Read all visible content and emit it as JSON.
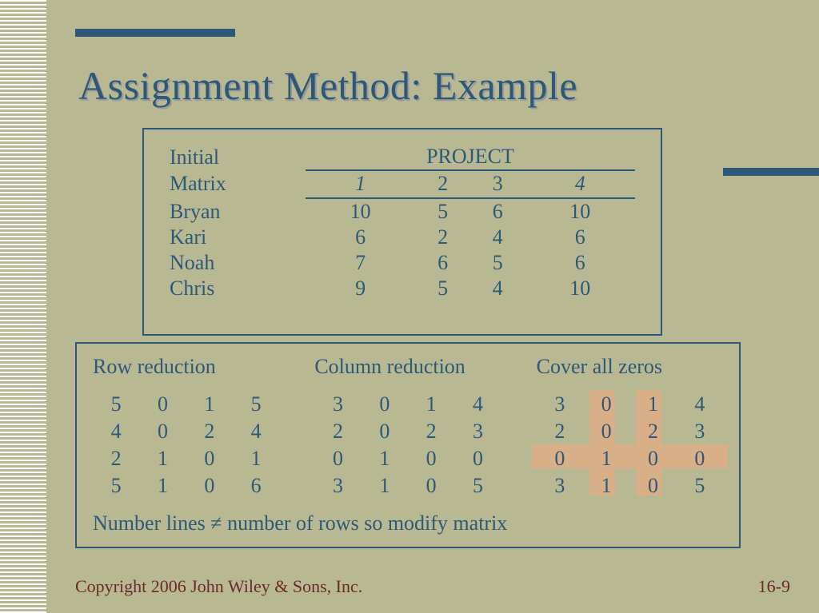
{
  "title": "Assignment Method: Example",
  "initial": {
    "label1": "Initial",
    "proj_header": "PROJECT",
    "label2": "Matrix",
    "cols": [
      "1",
      "2",
      "3",
      "4"
    ],
    "rows": [
      {
        "name": "Bryan",
        "v": [
          "10",
          "5",
          "6",
          "10"
        ]
      },
      {
        "name": "Kari",
        "v": [
          "6",
          "2",
          "4",
          "6"
        ]
      },
      {
        "name": "Noah",
        "v": [
          "7",
          "6",
          "5",
          "6"
        ]
      },
      {
        "name": "Chris",
        "v": [
          "9",
          "5",
          "4",
          "10"
        ]
      }
    ]
  },
  "lower": {
    "row_red": {
      "title": "Row reduction",
      "m": [
        [
          "5",
          "0",
          "1",
          "5"
        ],
        [
          "4",
          "0",
          "2",
          "4"
        ],
        [
          "2",
          "1",
          "0",
          "1"
        ],
        [
          "5",
          "1",
          "0",
          "6"
        ]
      ]
    },
    "col_red": {
      "title": "Column reduction",
      "m": [
        [
          "3",
          "0",
          "1",
          "4"
        ],
        [
          "2",
          "0",
          "2",
          "3"
        ],
        [
          "0",
          "1",
          "0",
          "0"
        ],
        [
          "3",
          "1",
          "0",
          "5"
        ]
      ]
    },
    "cover": {
      "title": "Cover all zeros",
      "m": [
        [
          "3",
          "0",
          "1",
          "4"
        ],
        [
          "2",
          "0",
          "2",
          "3"
        ],
        [
          "0",
          "1",
          "0",
          "0"
        ],
        [
          "3",
          "1",
          "0",
          "5"
        ]
      ]
    },
    "note": "Number lines ≠ number of rows so modify matrix"
  },
  "footer": {
    "left": "Copyright 2006 John Wiley & Sons, Inc.",
    "right": "16-9"
  }
}
